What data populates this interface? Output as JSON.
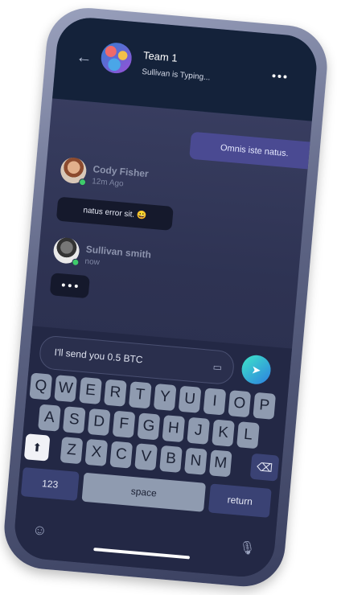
{
  "header": {
    "back_icon": "arrow-left-icon",
    "title": "Team 1",
    "subtitle": "Sullivan is Typing...",
    "more_icon": "more-horizontal-icon"
  },
  "messages": {
    "outgoing_text": "Omnis iste natus.",
    "cody": {
      "name": "Cody Fisher",
      "time": "12m Ago",
      "text": "natus error sit. 😀"
    },
    "sullivan": {
      "name": "Sullivan smith",
      "time": "now"
    }
  },
  "composer": {
    "value": "I'll send you 0.5 BTC",
    "attach_icon": "attach-file-icon",
    "send_icon": "send-icon"
  },
  "keyboard": {
    "row1": [
      "Q",
      "W",
      "E",
      "R",
      "T",
      "Y",
      "U",
      "I",
      "O",
      "P"
    ],
    "row2": [
      "A",
      "S",
      "D",
      "F",
      "G",
      "H",
      "J",
      "K",
      "L"
    ],
    "row3": [
      "Z",
      "X",
      "C",
      "V",
      "B",
      "N",
      "M"
    ],
    "numbers_label": "123",
    "space_label": "space",
    "return_label": "return",
    "shift_icon": "shift-icon",
    "backspace_icon": "backspace-icon",
    "emoji_icon": "emoji-icon",
    "mic_icon": "microphone-icon"
  },
  "colors": {
    "accent_bubble": "#4a4a92",
    "send_gradient_start": "#3ee6c8",
    "send_gradient_end": "#2d7fe0",
    "online": "#3ecb6b"
  }
}
